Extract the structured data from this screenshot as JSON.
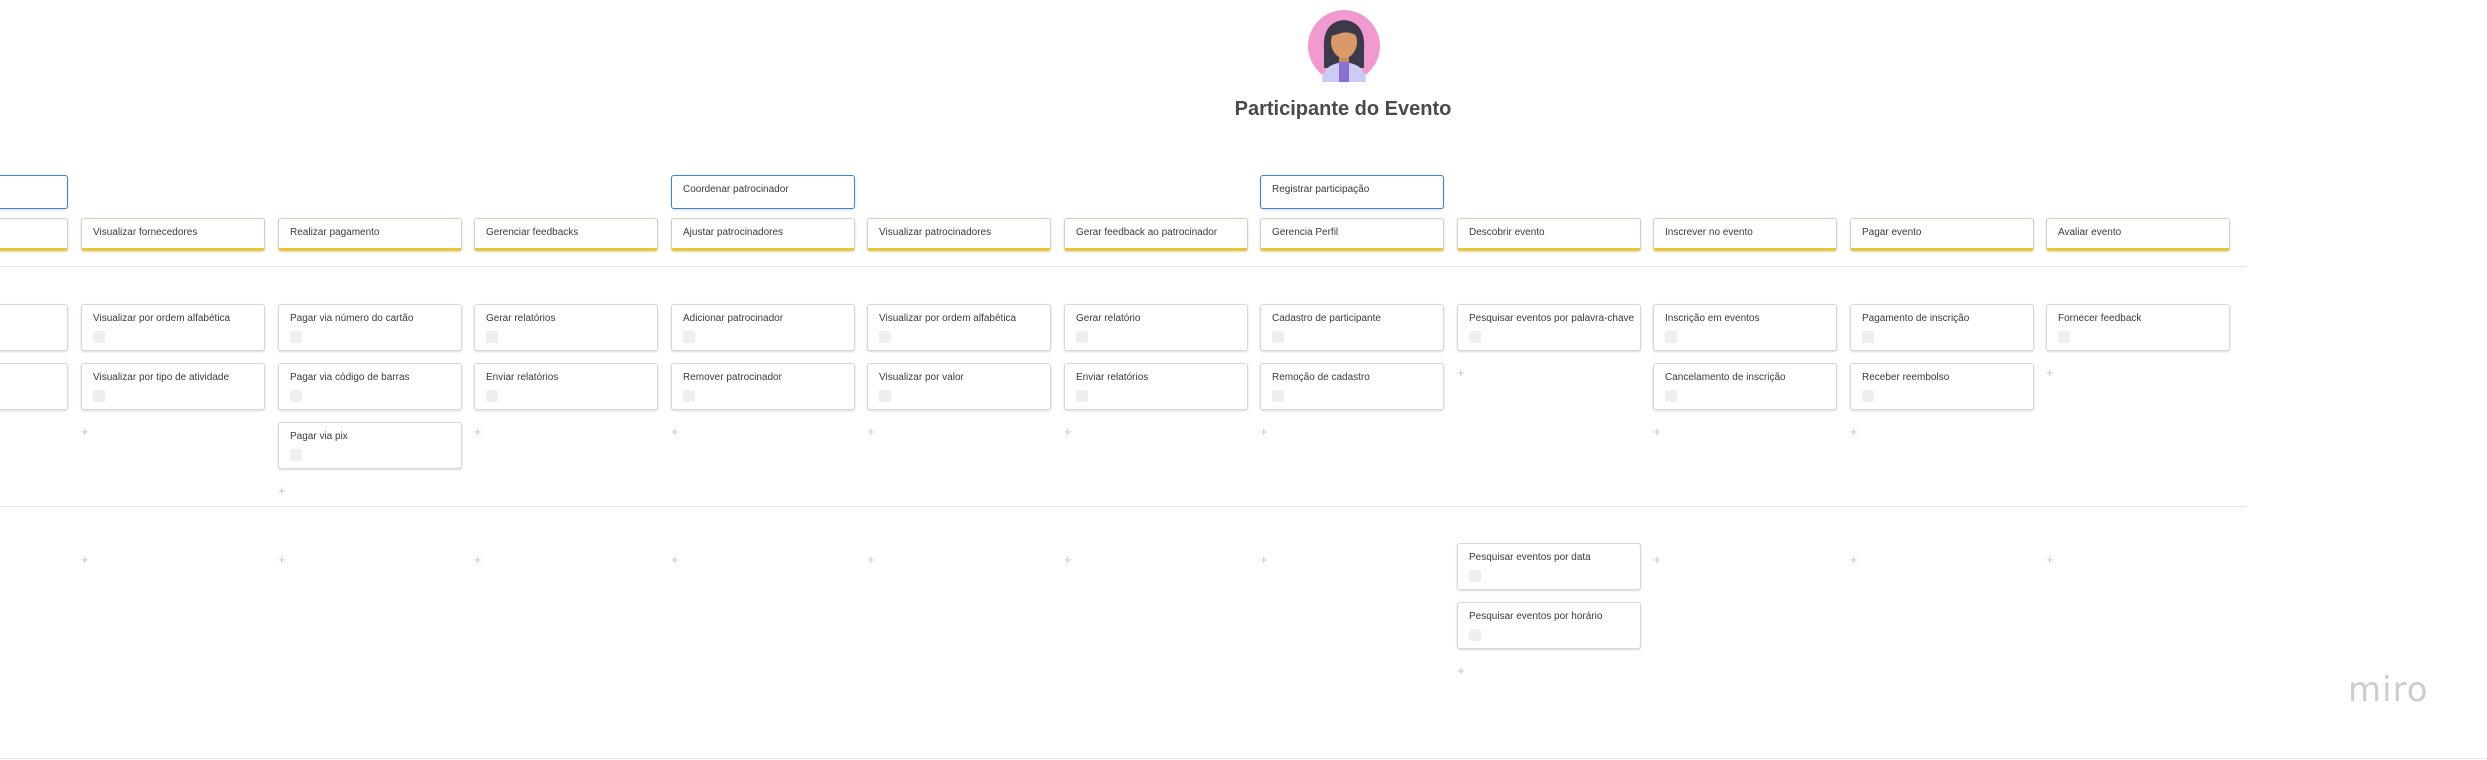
{
  "persona": {
    "title": "Participante do Evento"
  },
  "activities": [
    {
      "label": ""
    },
    {
      "label": "Coordenar patrocinador"
    },
    {
      "label": "Registrar participação"
    }
  ],
  "steps": [
    {
      "label": ""
    },
    {
      "label": "Visualizar fornecedores"
    },
    {
      "label": "Realizar pagamento"
    },
    {
      "label": "Gerenciar feedbacks"
    },
    {
      "label": "Ajustar patrocinadores"
    },
    {
      "label": "Visualizar patrocinadores"
    },
    {
      "label": "Gerar feedback ao patrocinador"
    },
    {
      "label": "Gerencia Perfil"
    },
    {
      "label": "Descobrir evento"
    },
    {
      "label": "Inscrever no evento"
    },
    {
      "label": "Pagar evento"
    },
    {
      "label": "Avaliar evento"
    }
  ],
  "tasks": [
    {
      "label": ""
    },
    {
      "label": ""
    },
    {
      "label": "Visualizar por ordem alfabética"
    },
    {
      "label": "Visualizar por tipo de atividade"
    },
    {
      "label": "Pagar via número do cartão"
    },
    {
      "label": "Pagar via código de barras"
    },
    {
      "label": "Pagar via pix"
    },
    {
      "label": "Gerar relatórios"
    },
    {
      "label": "Enviar relatórios"
    },
    {
      "label": "Adicionar patrocinador"
    },
    {
      "label": "Remover patrocinador"
    },
    {
      "label": "Visualizar por ordem alfabética"
    },
    {
      "label": "Visualizar por valor"
    },
    {
      "label": "Gerar relatório"
    },
    {
      "label": "Enviar relatórios"
    },
    {
      "label": "Cadastro de participante"
    },
    {
      "label": "Remoção de cadastro"
    },
    {
      "label": "Pesquisar eventos por palavra-chave"
    },
    {
      "label": "Inscrição em eventos"
    },
    {
      "label": "Cancelamento de inscrição"
    },
    {
      "label": "Pagamento de inscrição"
    },
    {
      "label": "Receber reembolso"
    },
    {
      "label": "Fornecer feedback"
    },
    {
      "label": "Pesquisar eventos por data"
    },
    {
      "label": "Pesquisar eventos por horário"
    }
  ],
  "add_symbol": "+",
  "brand": {
    "logo_text": "miro",
    "accent_activity": "#2f88d8",
    "accent_step": "#ecc62f"
  }
}
